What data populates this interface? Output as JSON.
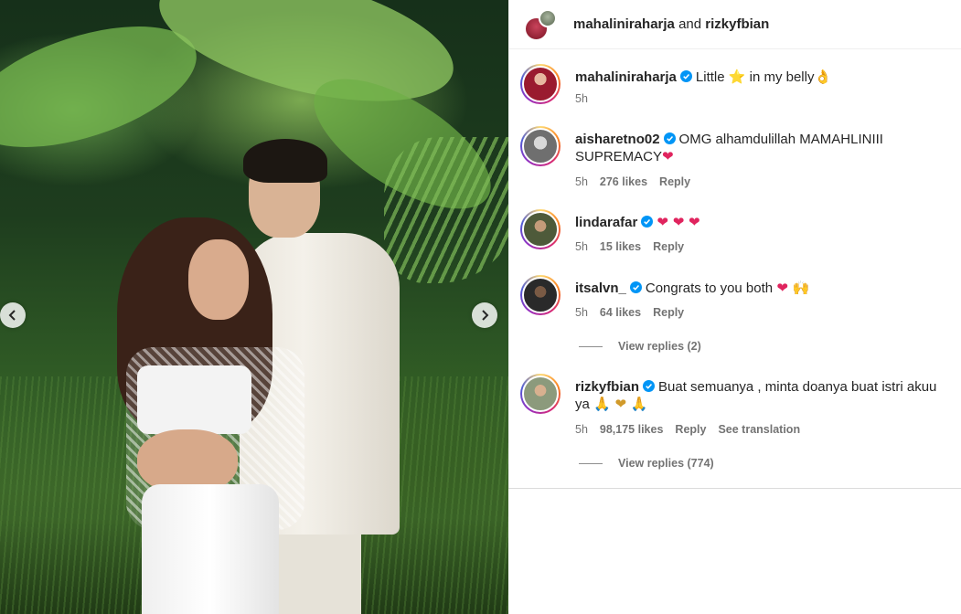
{
  "post": {
    "header_user1": "mahaliniraharja",
    "header_and": "and",
    "header_user2": "rizkyfbian"
  },
  "colors": {
    "verified": "#0095f6",
    "meta_text": "#737373",
    "heart": "#e0245e"
  },
  "comments": [
    {
      "username": "mahaliniraharja",
      "verified": true,
      "text_before": "Little",
      "emoji1": "⭐",
      "text_after": "in my belly",
      "emoji2": "👌",
      "time": "5h"
    },
    {
      "username": "aisharetno02",
      "verified": true,
      "text": "OMG alhamdulillah MAMAHLINIII SUPREMACY",
      "emoji": "❤",
      "time": "5h",
      "likes": "276 likes",
      "reply": "Reply"
    },
    {
      "username": "lindarafar",
      "verified": true,
      "emoji": "❤ ❤ ❤",
      "time": "5h",
      "likes": "15 likes",
      "reply": "Reply"
    },
    {
      "username": "itsalvn_",
      "verified": true,
      "text": "Congrats to you both",
      "emoji": "❤ 🙌",
      "time": "5h",
      "likes": "64 likes",
      "reply": "Reply",
      "view_replies": "View replies (2)"
    },
    {
      "username": "rizkyfbian",
      "verified": true,
      "text": "Buat semuanya , minta doanya buat istri akuu ya",
      "emoji": "🙏 ❤ 🙏",
      "time": "5h",
      "likes": "98,175 likes",
      "reply": "Reply",
      "translate": "See translation",
      "view_replies": "View replies (774)"
    }
  ],
  "icons": {
    "prev": "chevron-left-icon",
    "next": "chevron-right-icon",
    "verified": "verified-badge-icon"
  }
}
